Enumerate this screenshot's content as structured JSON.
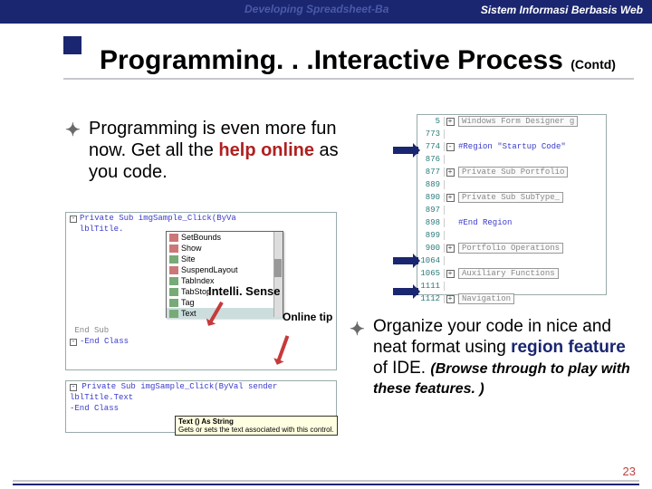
{
  "header": {
    "watermark": "Developing Spreadsheet-Ba",
    "subtitle_right": "Sistem Informasi Berbasis Web"
  },
  "title": {
    "main": "Programming. . .Interactive Process ",
    "suffix": "(Contd)"
  },
  "bullets": {
    "left_pre": "Programming is even more fun now. Get all the ",
    "left_em": "help online",
    "left_post": " as you code.",
    "right_pre": "Organize your code in nice and neat format using ",
    "right_em": "region feature",
    "right_post": " of IDE. ",
    "right_sub": "(Browse through to play with these features. )"
  },
  "labels": {
    "intellisense": "Intelli. Sense",
    "online_tip": "Online tip"
  },
  "code_left_top": {
    "line1": "Private Sub imgSample_Click(ByVa",
    "line2": "  lblTitle.",
    "line3": " End Sub",
    "line4": "-End Class",
    "popup_items": [
      "SetBounds",
      "Show",
      "Site",
      "SuspendLayout",
      "TabIndex",
      "TabStop",
      "Tag",
      "Text"
    ]
  },
  "code_left_bottom": {
    "line1": "Private Sub imgSample_Click(ByVal sender",
    "line2": "  lblTitle.Text",
    "line3": "-End Class",
    "tooltip_label": "Text () As String",
    "tooltip_text": "Gets or sets the text associated with this control."
  },
  "code_right": {
    "rows": [
      {
        "ln": "5",
        "exp": "+",
        "txt": "Windows Form Designer g",
        "boxed": true
      },
      {
        "ln": "773",
        "exp": "",
        "txt": ""
      },
      {
        "ln": "774",
        "exp": "-",
        "txt": "#Region \"Startup Code\"",
        "kw": true
      },
      {
        "ln": "876",
        "exp": "",
        "txt": ""
      },
      {
        "ln": "877",
        "exp": "+",
        "txt": "Private Sub Portfolio",
        "boxed": true
      },
      {
        "ln": "889",
        "exp": "",
        "txt": ""
      },
      {
        "ln": "890",
        "exp": "+",
        "txt": "Private Sub SubType_",
        "boxed": true
      },
      {
        "ln": "897",
        "exp": "",
        "txt": ""
      },
      {
        "ln": "898",
        "exp": "",
        "txt": "#End Region",
        "kw": true
      },
      {
        "ln": "899",
        "exp": "",
        "txt": ""
      },
      {
        "ln": "900",
        "exp": "+",
        "txt": "Portfolio Operations",
        "boxed": true
      },
      {
        "ln": "1064",
        "exp": "",
        "txt": ""
      },
      {
        "ln": "1065",
        "exp": "+",
        "txt": "Auxiliary Functions",
        "boxed": true
      },
      {
        "ln": "1111",
        "exp": "",
        "txt": ""
      },
      {
        "ln": "1112",
        "exp": "+",
        "txt": "Navigation",
        "boxed": true
      }
    ]
  },
  "page_number": "23"
}
